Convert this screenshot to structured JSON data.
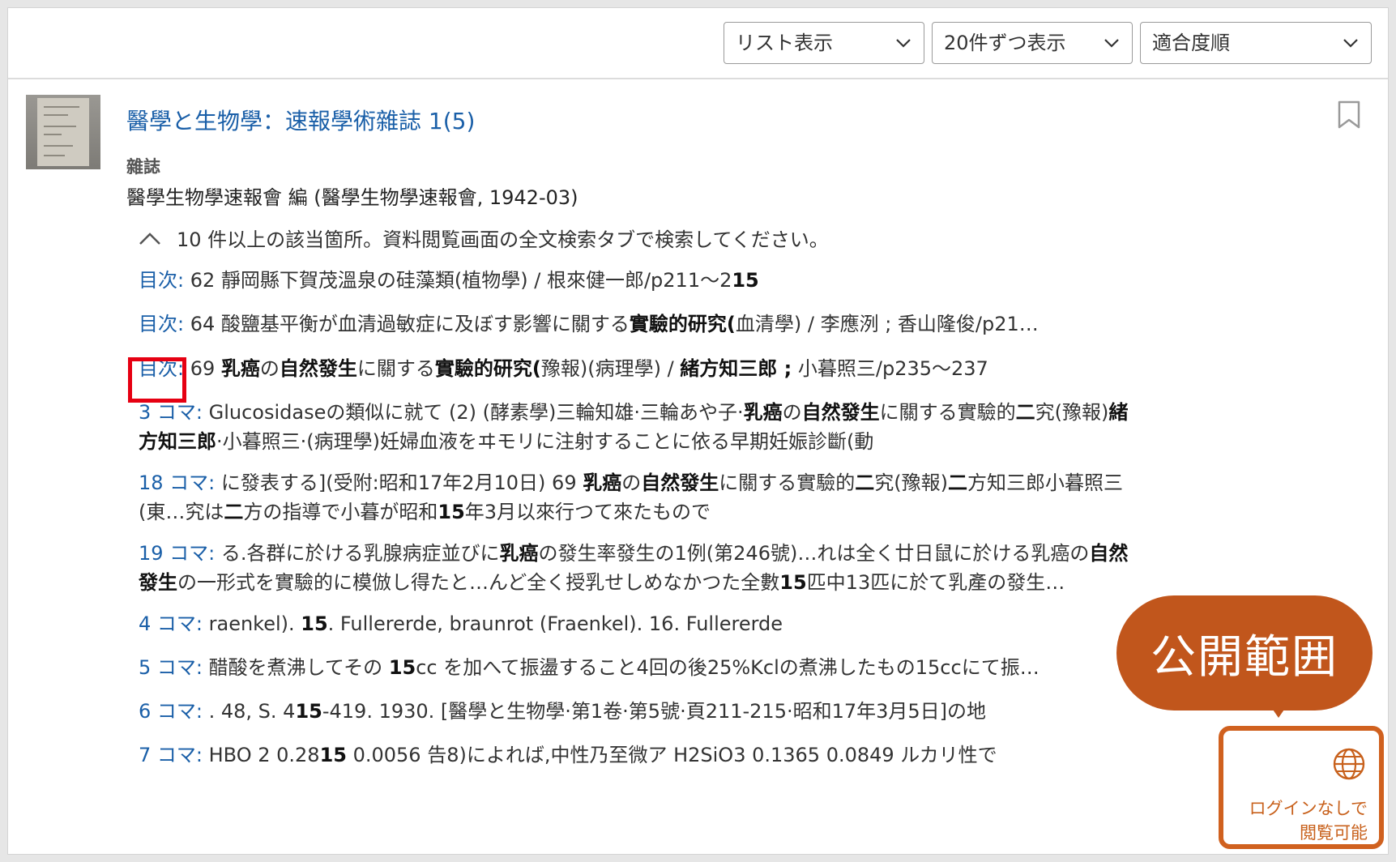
{
  "toolbar": {
    "view": "リスト表示",
    "per_page": "20件ずつ表示",
    "sort": "適合度順"
  },
  "result": {
    "title": "醫學と生物學：速報學術雜誌 1(5)",
    "type": "雜誌",
    "author": "醫學生物學速報會 編 (醫學生物學速報會, 1942-03)",
    "notice": "10 件以上の該当箇所。資料閲覧画面の全文検索タブで検索してください。",
    "hits": [
      {
        "label": "目次:",
        "text": " 62 靜岡縣下賀茂溫泉の硅藻類(植物學) / 根來健一郎/p211〜2",
        "bold": "15",
        "rest": ""
      },
      {
        "label": "目次:",
        "text": " 64 酸鹽基平衡が血清過敏症に及ぼす影響に關する",
        "bold": "實驗的研究(",
        "rest": "血清學) / 李應洌 ; 香山隆俊/p21…"
      },
      {
        "label": "目次:",
        "text": " 69 ",
        "bold": "乳癌",
        "rest": "の",
        "bold2": "自然發生",
        "rest2": "に關する",
        "bold3": "實驗的研究(",
        "rest3": "豫報)(病理學) / ",
        "bold4": "緒方知三郎 ;",
        "rest4": " 小暮照三/p235〜237"
      },
      {
        "label": "3 コマ:",
        "text": " Glucosidaseの類似に就て (2) (酵素學)三輪知雄·三輪あや子·",
        "bold": "乳癌",
        "rest": "の",
        "bold2": "自然發生",
        "rest2": "に關する實驗的",
        "bold3": "二",
        "rest3": "究(豫報)",
        "bold4": "緒方知三郎",
        "rest4": "·小暮照三·(病理學)妊婦血液をヰモリに注射することに依る早期妊娠診斷(動"
      },
      {
        "label": "18 コマ:",
        "text": " に發表する](受附:昭和17年2月10日) 69 ",
        "bold": "乳癌",
        "rest": "の",
        "bold2": "自然發生",
        "rest2": "に關する實驗的",
        "bold3": "二",
        "rest3": "究(豫報)",
        "bold4": "二",
        "rest4": "方知三郎小暮照三(東…究は",
        "bold5": "二",
        "rest5": "方の指導で小暮が昭和",
        "bold6": "15",
        "rest6": "年3月以來行つて來たもので"
      },
      {
        "label": "19 コマ:",
        "text": " る.各群に於ける乳腺病症並びに",
        "bold": "乳癌",
        "rest": "の發生率發生の1例(第246號)…れは全く廿日鼠に於ける乳癌の",
        "bold2": "自然發生",
        "rest2": "の一形式を實驗的に模倣し得たと…んど全く授乳せしめなかつた全數",
        "bold3": "15",
        "rest3": "匹中13匹に於て乳產の發生…"
      },
      {
        "label": "4 コマ:",
        "text": " raenkel). ",
        "bold": "15",
        "rest": ". Fullererde, braunrot (Fraenkel). 16. Fullererde"
      },
      {
        "label": "5 コマ:",
        "text": " 醋酸を煮沸してその ",
        "bold": "15",
        "rest": "cc を加へて振盪すること4回の後25%Kclの煮沸したもの15ccにて振…"
      },
      {
        "label": "6 コマ:",
        "text": " . 48, S. 4",
        "bold": "15",
        "rest": "-419. 1930. [醫學と生物學·第1卷·第5號·頁211-215·昭和17年3月5日]の地"
      },
      {
        "label": "7 コマ:",
        "text": " HBO 2 0.28",
        "bold": "15",
        "rest": " 0.0056 告8)によれば,中性乃至微ア H2SiO3 0.1365 0.0849 ルカリ性で"
      }
    ]
  },
  "callout": {
    "label": "公開範囲",
    "access_line1": "ログインなしで",
    "access_line2": "閲覧可能"
  }
}
